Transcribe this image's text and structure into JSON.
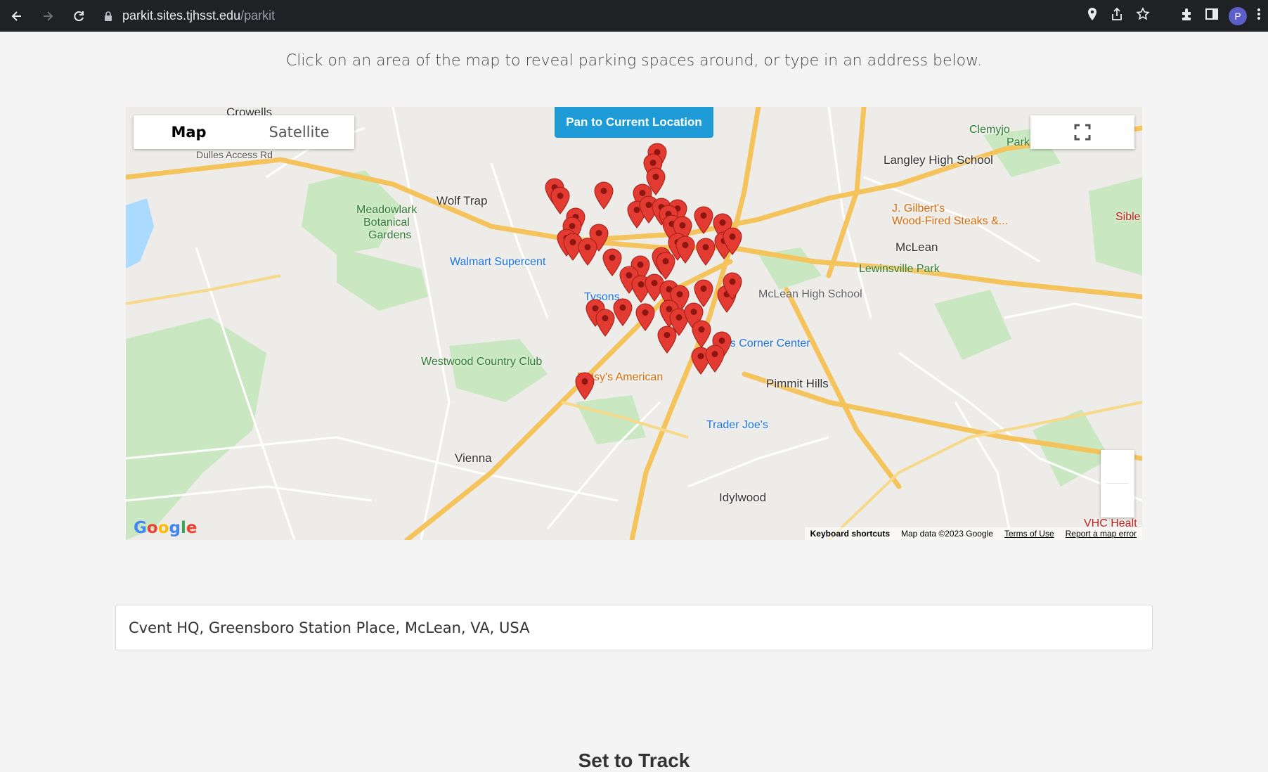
{
  "browser": {
    "url_host": "parkit.sites.tjhsst.edu",
    "url_path": "/parkit",
    "profile_initial": "P"
  },
  "page": {
    "instruction": "Click on an area of the map to reveal parking spaces around, or type in an address below.",
    "address_value": "Cvent HQ, Greensboro Station Place, McLean, VA, USA",
    "section_heading": "Set to Track"
  },
  "map": {
    "type_options": [
      "Map",
      "Satellite"
    ],
    "selected_type": "Map",
    "pan_button": "Pan to Current Location",
    "logo": [
      "G",
      "o",
      "o",
      "g",
      "l",
      "e"
    ],
    "attribution": {
      "keyboard": "Keyboard shortcuts",
      "data": "Map data ©2023 Google",
      "terms": "Terms of Use",
      "report": "Report a map error"
    },
    "labels": {
      "crowells": "Crowells",
      "wolf_trap": "Wolf Trap",
      "meadowlark": "Meadowlark",
      "botanical": "Botanical",
      "gardens": "Gardens",
      "walmart": "Walmart Supercent",
      "westwood": "Westwood Country Club",
      "vienna": "Vienna",
      "tysons": "Tysons",
      "patsys": "Patsy's American",
      "tysons_corner": "sons Corner Center",
      "pimmit": "Pimmit Hills",
      "trader": "Trader Joe's",
      "idylwood": "Idylwood",
      "mclean": "McLean",
      "lewinsville": "Lewinsville Park",
      "mclean_hs": "McLean High School",
      "langley": "Langley High School",
      "jgilberts_1": "J. Gilbert's",
      "jgilberts_2": "Wood-Fired Steaks &...",
      "clemyjontri_1": "Clemyjo",
      "clemyjontri_2": "Park",
      "sible": "Sible",
      "vhc": "VHC Healt",
      "dulles_access": "Dulles Access Rd"
    },
    "marker_count": 52
  },
  "colors": {
    "marker": "#e33b32",
    "primary_button": "#1e9bd7",
    "highway": "#f5c35b",
    "park": "#c9e7c1"
  }
}
